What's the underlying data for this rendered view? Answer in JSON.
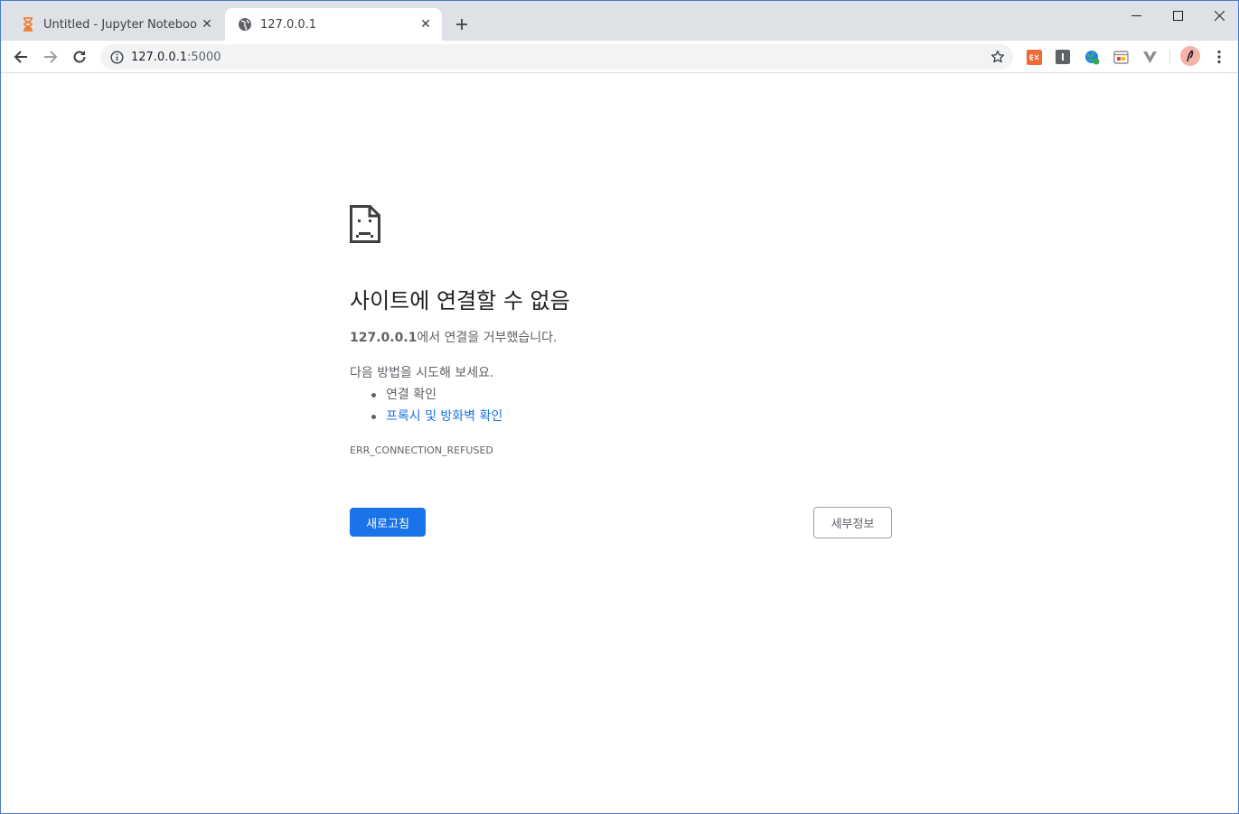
{
  "tabs": [
    {
      "title": "Untitled - Jupyter Notebook",
      "favicon": "hourglass-icon",
      "active": false
    },
    {
      "title": "127.0.0.1",
      "favicon": "globe-icon",
      "active": true
    }
  ],
  "omnibox": {
    "host": "127.0.0.1",
    "port": ":5000"
  },
  "error": {
    "heading": "사이트에 연결할 수 없음",
    "host_bold": "127.0.0.1",
    "desc_rest": "에서 연결을 거부했습니다.",
    "try_text": "다음 방법을 시도해 보세요.",
    "suggestions": [
      "연결 확인",
      "프록시 및 방화벽 확인"
    ],
    "code": "ERR_CONNECTION_REFUSED",
    "reload_label": "새로고침",
    "details_label": "세부정보"
  },
  "colors": {
    "accent": "#1a73e8",
    "tabstrip": "#dee1e6",
    "omnibox": "#f1f3f4",
    "text_secondary": "#5f6368"
  }
}
